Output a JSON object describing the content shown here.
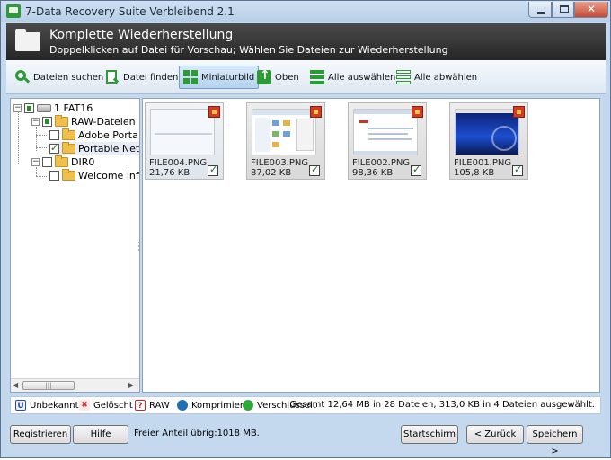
{
  "window": {
    "title": "7-Data Recovery Suite Verbleibend 2.1",
    "controls": {
      "minimize": "",
      "maximize": "",
      "close": "✕"
    }
  },
  "header": {
    "title": "Komplette Wiederherstellung",
    "subtitle": "Doppelklicken auf Datei für Vorschau; Wählen Sie Dateien zur Wiederherstellung"
  },
  "toolbar": {
    "items": [
      {
        "label": "Dateien suchen",
        "icon": "search-icon"
      },
      {
        "label": "Datei finden",
        "icon": "find-file-icon"
      },
      {
        "label": "Miniaturbild",
        "icon": "thumbnail-icon",
        "active": true
      },
      {
        "label": "Oben",
        "icon": "up-icon"
      },
      {
        "label": "Alle auswählen",
        "icon": "select-all-icon"
      },
      {
        "label": "Alle abwählen",
        "icon": "deselect-all-icon"
      }
    ]
  },
  "tree": {
    "nodes": [
      {
        "label": "1 FAT16",
        "level": 0,
        "type": "drive",
        "check": "partial"
      },
      {
        "label": "RAW-Dateien",
        "level": 1,
        "type": "folder",
        "check": "partial"
      },
      {
        "label": "Adobe Porta",
        "level": 2,
        "type": "folder",
        "check": "none"
      },
      {
        "label": "Portable Net",
        "level": 2,
        "type": "folder",
        "check": "checked"
      },
      {
        "label": "DIR0",
        "level": 1,
        "type": "folder",
        "check": "none"
      },
      {
        "label": "Welcome inf",
        "level": 2,
        "type": "folder",
        "check": "none"
      }
    ]
  },
  "files": [
    {
      "name": "FILE004.PNG",
      "size": "21,76 KB",
      "checked": true
    },
    {
      "name": "FILE003.PNG",
      "size": "87,02 KB",
      "checked": true
    },
    {
      "name": "FILE002.PNG",
      "size": "98,36 KB",
      "checked": true
    },
    {
      "name": "FILE001.PNG",
      "size": "105,8 KB",
      "checked": true
    }
  ],
  "legend": {
    "items": [
      {
        "label": "Unbekannt",
        "glyph": "U",
        "color": "#2a4ea8"
      },
      {
        "label": "Gelöscht",
        "glyph": "✖",
        "color": "#d32f2f"
      },
      {
        "label": "RAW",
        "glyph": "?",
        "color": "#c62828"
      },
      {
        "label": "Komprimiert",
        "glyph": "",
        "color": "#1e6fb8"
      },
      {
        "label": "Verschlüsselt",
        "glyph": "",
        "color": "#2eaa3a"
      }
    ],
    "summary": "Gesamt 12,64 MB in 28 Dateien, 313,0 KB in 4 Dateien ausgewählt."
  },
  "footer": {
    "register": "Registrieren",
    "help": "Hilfe",
    "free_space": "Freier Anteil übrig:1018 MB.",
    "start": "Startschirm",
    "back": "< Zurück",
    "save": "Speichern >"
  }
}
